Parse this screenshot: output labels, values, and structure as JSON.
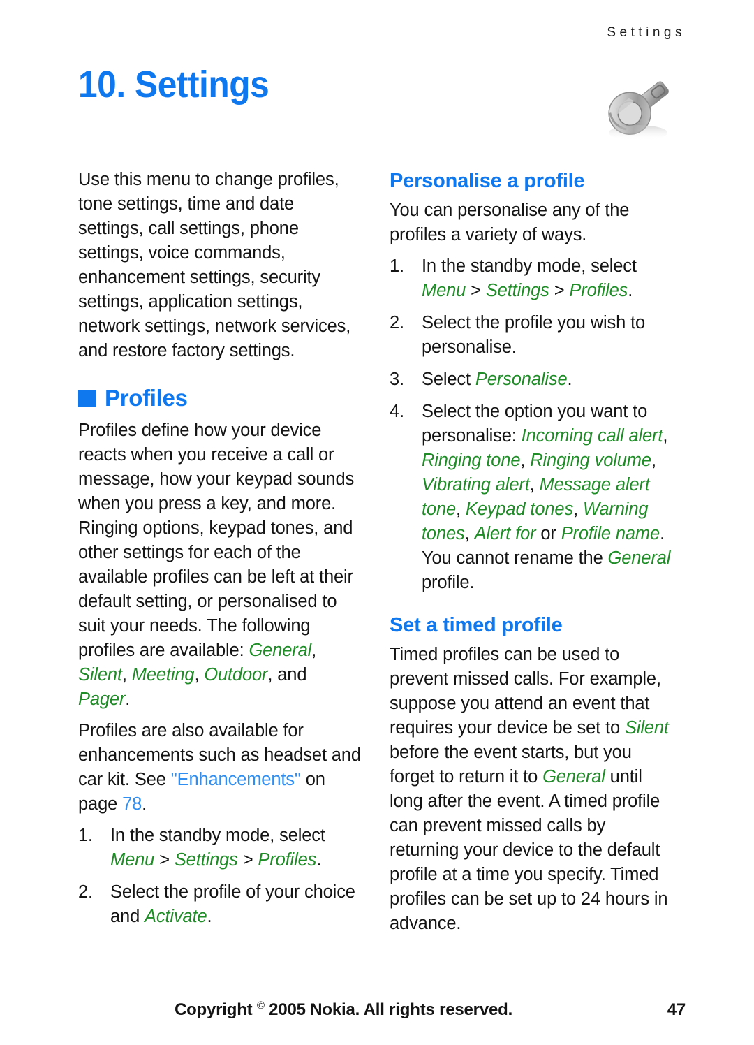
{
  "running_head": "Settings",
  "chapter": {
    "number": "10.",
    "title": "Settings",
    "full_title": "10. Settings",
    "icon": "wrench-icon"
  },
  "colors": {
    "heading_blue": "#0f78ef",
    "ui_term_green": "#1f8c28",
    "xref_blue": "#2f8ef0",
    "body_text": "#141414"
  },
  "left_column": {
    "intro_paragraph": "Use this menu to change profiles, tone settings, time and date settings, call settings, phone settings, voice commands, enhancement settings, security settings, application settings, network settings, network services, and restore factory settings.",
    "section_heading": "Profiles",
    "paragraph_1_part1": "Profiles define how your device reacts when you receive a call or message, how your keypad sounds when you press a key, and more. Ringing options, keypad tones, and other settings for each of the available profiles can be left at their default setting, or personalised to suit your needs. The following profiles are available: ",
    "profile_general": "General",
    "comma_1": ", ",
    "profile_silent": "Silent",
    "comma_2": ", ",
    "profile_meeting": "Meeting",
    "comma_3": ", ",
    "profile_outdoor": "Outdoor",
    "and_text": ", and ",
    "profile_pager": "Pager",
    "period_1": ".",
    "paragraph_2_part1": "Profiles are also available for enhancements such as headset and car kit. See ",
    "xref_enhancements": "\"Enhancements\"",
    "paragraph_2_part2": " on page ",
    "xref_page": "78",
    "period_2": ".",
    "steps": [
      {
        "num": "1.",
        "text_before": "In the standby mode, select ",
        "ui_1": "Menu",
        "sep_1": " > ",
        "ui_2": "Settings",
        "sep_2": " > ",
        "ui_3": "Profiles",
        "text_after": "."
      },
      {
        "num": "2.",
        "text_before": "Select the profile of your choice and ",
        "ui_1": "Activate",
        "text_after": "."
      }
    ]
  },
  "right_column": {
    "section_1": {
      "heading": "Personalise a profile",
      "intro": "You can personalise any of the profiles a variety of ways.",
      "steps": [
        {
          "num": "1.",
          "text_before": "In the standby mode, select ",
          "ui_1": "Menu",
          "sep_1": " > ",
          "ui_2": "Settings",
          "sep_2": " > ",
          "ui_3": "Profiles",
          "text_after": "."
        },
        {
          "num": "2.",
          "text": "Select the profile you wish to personalise."
        },
        {
          "num": "3.",
          "text_before": "Select ",
          "ui_1": "Personalise",
          "text_after": "."
        },
        {
          "num": "4.",
          "text_before": "Select the option you want to personalise: ",
          "opt_1": "Incoming call alert",
          "opt_sep_1": ", ",
          "opt_2": "Ringing tone",
          "opt_sep_2": ", ",
          "opt_3": "Ringing volume",
          "opt_sep_3": ", ",
          "opt_4": "Vibrating alert",
          "opt_sep_4": ", ",
          "opt_5": "Message alert tone",
          "opt_sep_5": ", ",
          "opt_6": "Keypad tones",
          "opt_sep_6": ", ",
          "opt_7": "Warning tones",
          "opt_sep_7": ", ",
          "opt_8": "Alert for",
          "opt_sep_8": " or ",
          "opt_9": "Profile name",
          "text_middle": ". You cannot rename the ",
          "ui_general": "General",
          "text_after": " profile."
        }
      ]
    },
    "section_2": {
      "heading": "Set a timed profile",
      "para_part1": "Timed profiles can be used to prevent missed calls. For example, suppose you attend an event that requires your device be set to ",
      "ui_silent": "Silent",
      "para_part2": " before the event starts, but you forget to return it to ",
      "ui_general": "General",
      "para_part3": " until long after the event. A timed profile can prevent missed calls by returning your device to the default profile at a time you specify. Timed profiles can be set up to 24 hours in advance."
    }
  },
  "footer": {
    "copyright_prefix": "Copyright ",
    "copyright_symbol": "©",
    "copyright_suffix": " 2005 Nokia. All rights reserved.",
    "page_number": "47"
  }
}
